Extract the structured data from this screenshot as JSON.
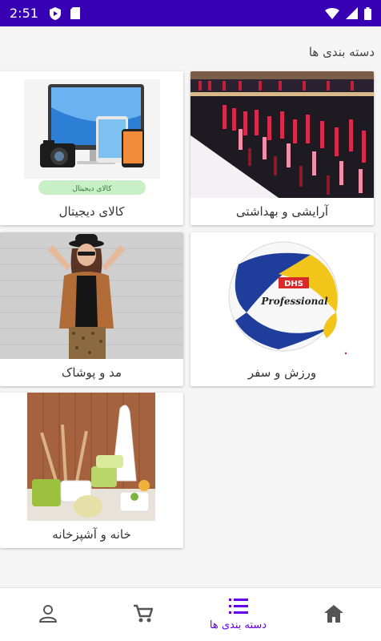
{
  "status_bar": {
    "time": "2:51",
    "icons": [
      "play-protect-icon",
      "sd-card-icon",
      "wifi-icon",
      "signal-icon",
      "battery-icon"
    ]
  },
  "page": {
    "title": "دسته بندی ها"
  },
  "categories": [
    {
      "label": "آرایشی و بهداشتی",
      "image": "cosmetics-shelf"
    },
    {
      "label": "کالای دیجیتال",
      "image": "digital-devices",
      "banner_text": "کالای دیجیتال"
    },
    {
      "label": "ورزش و سفر",
      "image": "volleyball",
      "ball_brand": "DHS",
      "ball_text": "Professional"
    },
    {
      "label": "مد و پوشاک",
      "image": "fashion-model"
    },
    {
      "label": "خانه و آشپزخانه",
      "image": "kitchenware"
    }
  ],
  "bottom_nav": {
    "items": [
      {
        "icon": "home-icon",
        "label": ""
      },
      {
        "icon": "list-icon",
        "label": "دسته بندی ها",
        "active": true
      },
      {
        "icon": "cart-icon",
        "label": ""
      },
      {
        "icon": "person-icon",
        "label": ""
      }
    ],
    "active_color": "#6200ee",
    "inactive_color": "#555555"
  },
  "colors": {
    "status_bar": "#3700b3",
    "accent": "#6200ee",
    "background": "#f5f5f5"
  }
}
